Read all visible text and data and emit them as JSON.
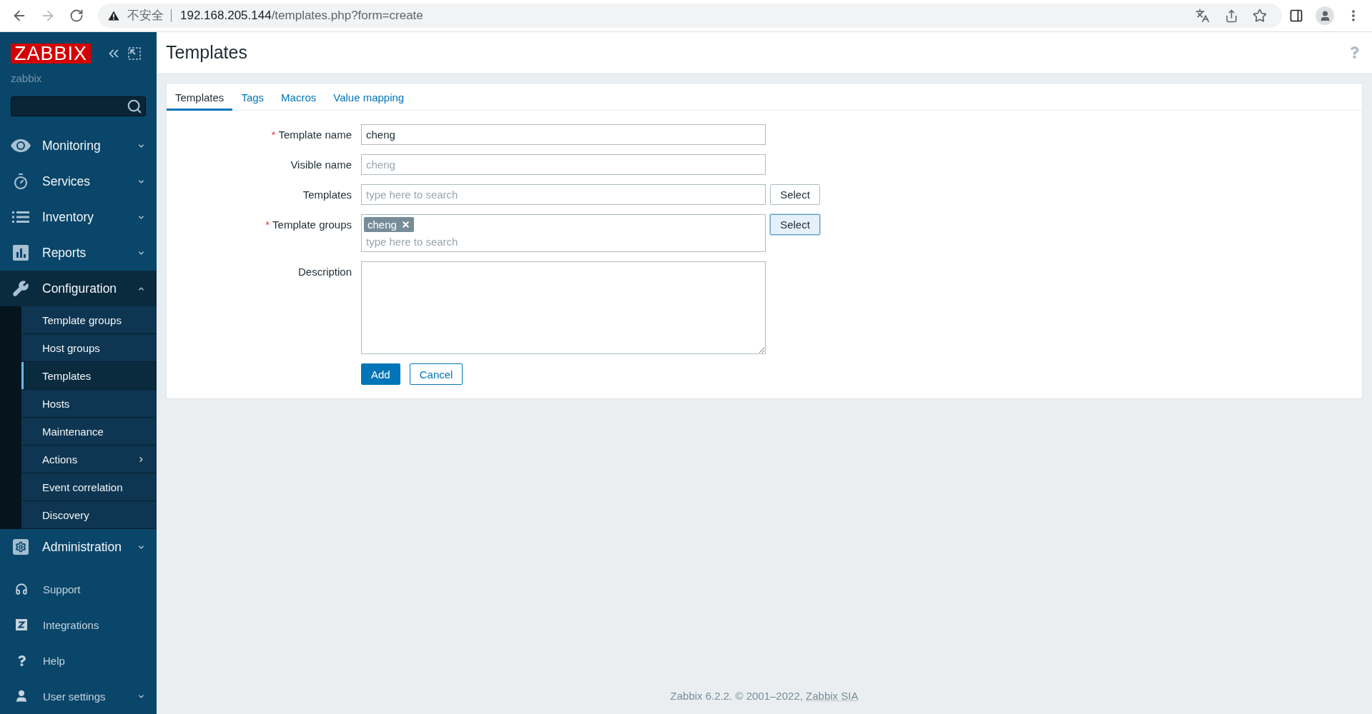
{
  "browser": {
    "forward_enabled": false,
    "security_label": "不安全",
    "url_host": "192.168.205.144",
    "url_path": "/templates.php?form=create"
  },
  "sidebar": {
    "logo": "ZABBIX",
    "server_name": "zabbix",
    "menu": [
      {
        "label": "Monitoring",
        "expanded": false
      },
      {
        "label": "Services",
        "expanded": false
      },
      {
        "label": "Inventory",
        "expanded": false
      },
      {
        "label": "Reports",
        "expanded": false
      },
      {
        "label": "Configuration",
        "expanded": true,
        "children": [
          {
            "label": "Template groups",
            "selected": false,
            "has_submenu": false
          },
          {
            "label": "Host groups",
            "selected": false,
            "has_submenu": false
          },
          {
            "label": "Templates",
            "selected": true,
            "has_submenu": false
          },
          {
            "label": "Hosts",
            "selected": false,
            "has_submenu": false
          },
          {
            "label": "Maintenance",
            "selected": false,
            "has_submenu": false
          },
          {
            "label": "Actions",
            "selected": false,
            "has_submenu": true
          },
          {
            "label": "Event correlation",
            "selected": false,
            "has_submenu": false
          },
          {
            "label": "Discovery",
            "selected": false,
            "has_submenu": false
          }
        ]
      },
      {
        "label": "Administration",
        "expanded": false
      }
    ],
    "bottom": [
      {
        "label": "Support",
        "kind": "link"
      },
      {
        "label": "Integrations",
        "kind": "link"
      },
      {
        "label": "Help",
        "kind": "link"
      },
      {
        "label": "User settings",
        "kind": "menu",
        "expanded": false
      }
    ]
  },
  "page": {
    "title": "Templates"
  },
  "tabs": [
    {
      "label": "Templates",
      "selected": true
    },
    {
      "label": "Tags",
      "selected": false
    },
    {
      "label": "Macros",
      "selected": false
    },
    {
      "label": "Value mapping",
      "selected": false
    }
  ],
  "form": {
    "fields": [
      {
        "kind": "text",
        "required_mark": "*",
        "label": "Template name",
        "value": "cheng"
      },
      {
        "kind": "text",
        "label": "Visible name",
        "placeholder": "cheng"
      },
      {
        "kind": "multiselect",
        "label": "Templates",
        "placeholder": "type here to search",
        "button": "Select",
        "focused": false
      },
      {
        "kind": "multiselect",
        "required_mark": "*",
        "label": "Template groups",
        "chips": [
          "cheng"
        ],
        "placeholder": "type here to search",
        "button": "Select",
        "focused": true
      },
      {
        "kind": "textarea",
        "label": "Description"
      }
    ],
    "actions": [
      {
        "label": "Add",
        "kind": "primary"
      },
      {
        "label": "Cancel",
        "kind": "secondary"
      }
    ]
  },
  "footer": {
    "text": "Zabbix 6.2.2. © 2001–2022,",
    "link": "Zabbix SIA"
  }
}
